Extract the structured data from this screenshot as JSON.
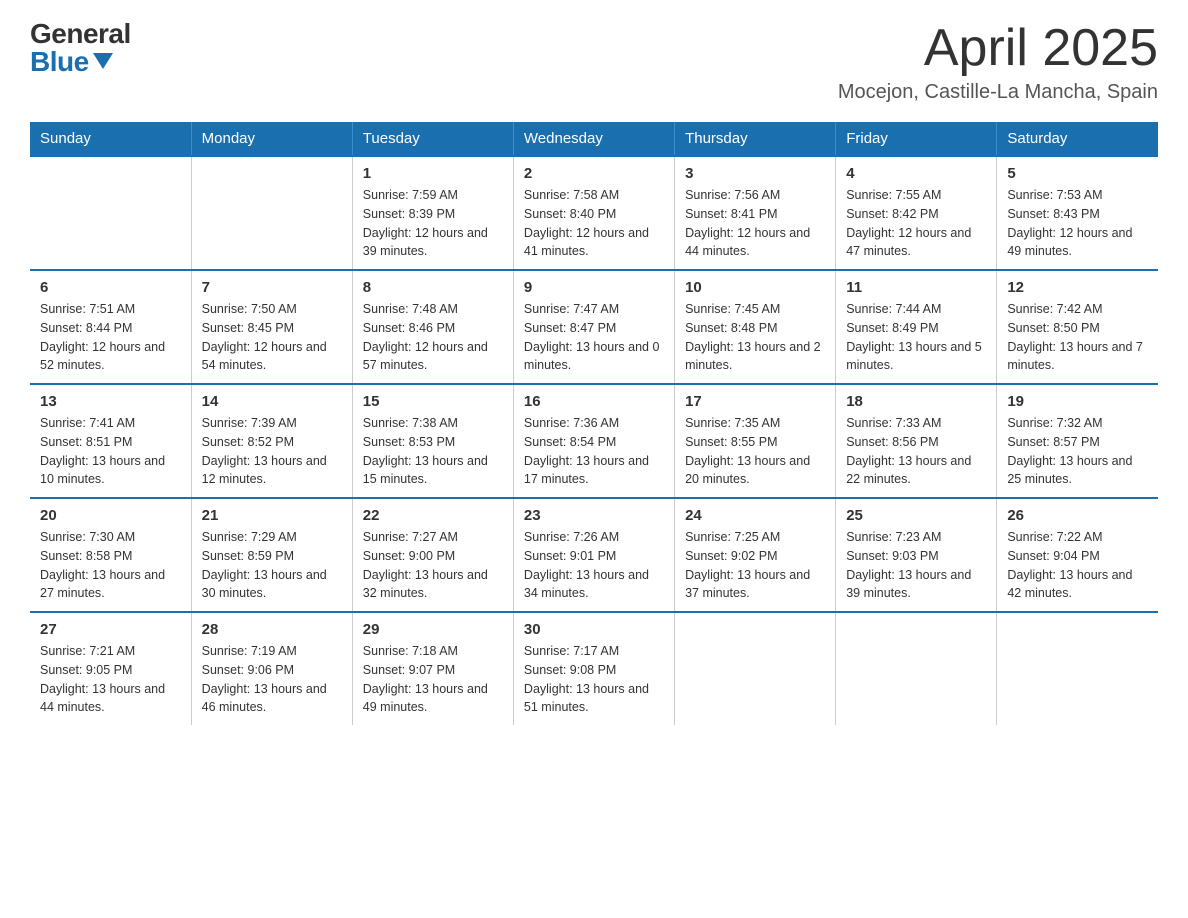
{
  "logo": {
    "general": "General",
    "blue": "Blue"
  },
  "header": {
    "month": "April 2025",
    "location": "Mocejon, Castille-La Mancha, Spain"
  },
  "weekdays": [
    "Sunday",
    "Monday",
    "Tuesday",
    "Wednesday",
    "Thursday",
    "Friday",
    "Saturday"
  ],
  "weeks": [
    [
      {
        "day": "",
        "sunrise": "",
        "sunset": "",
        "daylight": ""
      },
      {
        "day": "",
        "sunrise": "",
        "sunset": "",
        "daylight": ""
      },
      {
        "day": "1",
        "sunrise": "Sunrise: 7:59 AM",
        "sunset": "Sunset: 8:39 PM",
        "daylight": "Daylight: 12 hours and 39 minutes."
      },
      {
        "day": "2",
        "sunrise": "Sunrise: 7:58 AM",
        "sunset": "Sunset: 8:40 PM",
        "daylight": "Daylight: 12 hours and 41 minutes."
      },
      {
        "day": "3",
        "sunrise": "Sunrise: 7:56 AM",
        "sunset": "Sunset: 8:41 PM",
        "daylight": "Daylight: 12 hours and 44 minutes."
      },
      {
        "day": "4",
        "sunrise": "Sunrise: 7:55 AM",
        "sunset": "Sunset: 8:42 PM",
        "daylight": "Daylight: 12 hours and 47 minutes."
      },
      {
        "day": "5",
        "sunrise": "Sunrise: 7:53 AM",
        "sunset": "Sunset: 8:43 PM",
        "daylight": "Daylight: 12 hours and 49 minutes."
      }
    ],
    [
      {
        "day": "6",
        "sunrise": "Sunrise: 7:51 AM",
        "sunset": "Sunset: 8:44 PM",
        "daylight": "Daylight: 12 hours and 52 minutes."
      },
      {
        "day": "7",
        "sunrise": "Sunrise: 7:50 AM",
        "sunset": "Sunset: 8:45 PM",
        "daylight": "Daylight: 12 hours and 54 minutes."
      },
      {
        "day": "8",
        "sunrise": "Sunrise: 7:48 AM",
        "sunset": "Sunset: 8:46 PM",
        "daylight": "Daylight: 12 hours and 57 minutes."
      },
      {
        "day": "9",
        "sunrise": "Sunrise: 7:47 AM",
        "sunset": "Sunset: 8:47 PM",
        "daylight": "Daylight: 13 hours and 0 minutes."
      },
      {
        "day": "10",
        "sunrise": "Sunrise: 7:45 AM",
        "sunset": "Sunset: 8:48 PM",
        "daylight": "Daylight: 13 hours and 2 minutes."
      },
      {
        "day": "11",
        "sunrise": "Sunrise: 7:44 AM",
        "sunset": "Sunset: 8:49 PM",
        "daylight": "Daylight: 13 hours and 5 minutes."
      },
      {
        "day": "12",
        "sunrise": "Sunrise: 7:42 AM",
        "sunset": "Sunset: 8:50 PM",
        "daylight": "Daylight: 13 hours and 7 minutes."
      }
    ],
    [
      {
        "day": "13",
        "sunrise": "Sunrise: 7:41 AM",
        "sunset": "Sunset: 8:51 PM",
        "daylight": "Daylight: 13 hours and 10 minutes."
      },
      {
        "day": "14",
        "sunrise": "Sunrise: 7:39 AM",
        "sunset": "Sunset: 8:52 PM",
        "daylight": "Daylight: 13 hours and 12 minutes."
      },
      {
        "day": "15",
        "sunrise": "Sunrise: 7:38 AM",
        "sunset": "Sunset: 8:53 PM",
        "daylight": "Daylight: 13 hours and 15 minutes."
      },
      {
        "day": "16",
        "sunrise": "Sunrise: 7:36 AM",
        "sunset": "Sunset: 8:54 PM",
        "daylight": "Daylight: 13 hours and 17 minutes."
      },
      {
        "day": "17",
        "sunrise": "Sunrise: 7:35 AM",
        "sunset": "Sunset: 8:55 PM",
        "daylight": "Daylight: 13 hours and 20 minutes."
      },
      {
        "day": "18",
        "sunrise": "Sunrise: 7:33 AM",
        "sunset": "Sunset: 8:56 PM",
        "daylight": "Daylight: 13 hours and 22 minutes."
      },
      {
        "day": "19",
        "sunrise": "Sunrise: 7:32 AM",
        "sunset": "Sunset: 8:57 PM",
        "daylight": "Daylight: 13 hours and 25 minutes."
      }
    ],
    [
      {
        "day": "20",
        "sunrise": "Sunrise: 7:30 AM",
        "sunset": "Sunset: 8:58 PM",
        "daylight": "Daylight: 13 hours and 27 minutes."
      },
      {
        "day": "21",
        "sunrise": "Sunrise: 7:29 AM",
        "sunset": "Sunset: 8:59 PM",
        "daylight": "Daylight: 13 hours and 30 minutes."
      },
      {
        "day": "22",
        "sunrise": "Sunrise: 7:27 AM",
        "sunset": "Sunset: 9:00 PM",
        "daylight": "Daylight: 13 hours and 32 minutes."
      },
      {
        "day": "23",
        "sunrise": "Sunrise: 7:26 AM",
        "sunset": "Sunset: 9:01 PM",
        "daylight": "Daylight: 13 hours and 34 minutes."
      },
      {
        "day": "24",
        "sunrise": "Sunrise: 7:25 AM",
        "sunset": "Sunset: 9:02 PM",
        "daylight": "Daylight: 13 hours and 37 minutes."
      },
      {
        "day": "25",
        "sunrise": "Sunrise: 7:23 AM",
        "sunset": "Sunset: 9:03 PM",
        "daylight": "Daylight: 13 hours and 39 minutes."
      },
      {
        "day": "26",
        "sunrise": "Sunrise: 7:22 AM",
        "sunset": "Sunset: 9:04 PM",
        "daylight": "Daylight: 13 hours and 42 minutes."
      }
    ],
    [
      {
        "day": "27",
        "sunrise": "Sunrise: 7:21 AM",
        "sunset": "Sunset: 9:05 PM",
        "daylight": "Daylight: 13 hours and 44 minutes."
      },
      {
        "day": "28",
        "sunrise": "Sunrise: 7:19 AM",
        "sunset": "Sunset: 9:06 PM",
        "daylight": "Daylight: 13 hours and 46 minutes."
      },
      {
        "day": "29",
        "sunrise": "Sunrise: 7:18 AM",
        "sunset": "Sunset: 9:07 PM",
        "daylight": "Daylight: 13 hours and 49 minutes."
      },
      {
        "day": "30",
        "sunrise": "Sunrise: 7:17 AM",
        "sunset": "Sunset: 9:08 PM",
        "daylight": "Daylight: 13 hours and 51 minutes."
      },
      {
        "day": "",
        "sunrise": "",
        "sunset": "",
        "daylight": ""
      },
      {
        "day": "",
        "sunrise": "",
        "sunset": "",
        "daylight": ""
      },
      {
        "day": "",
        "sunrise": "",
        "sunset": "",
        "daylight": ""
      }
    ]
  ]
}
